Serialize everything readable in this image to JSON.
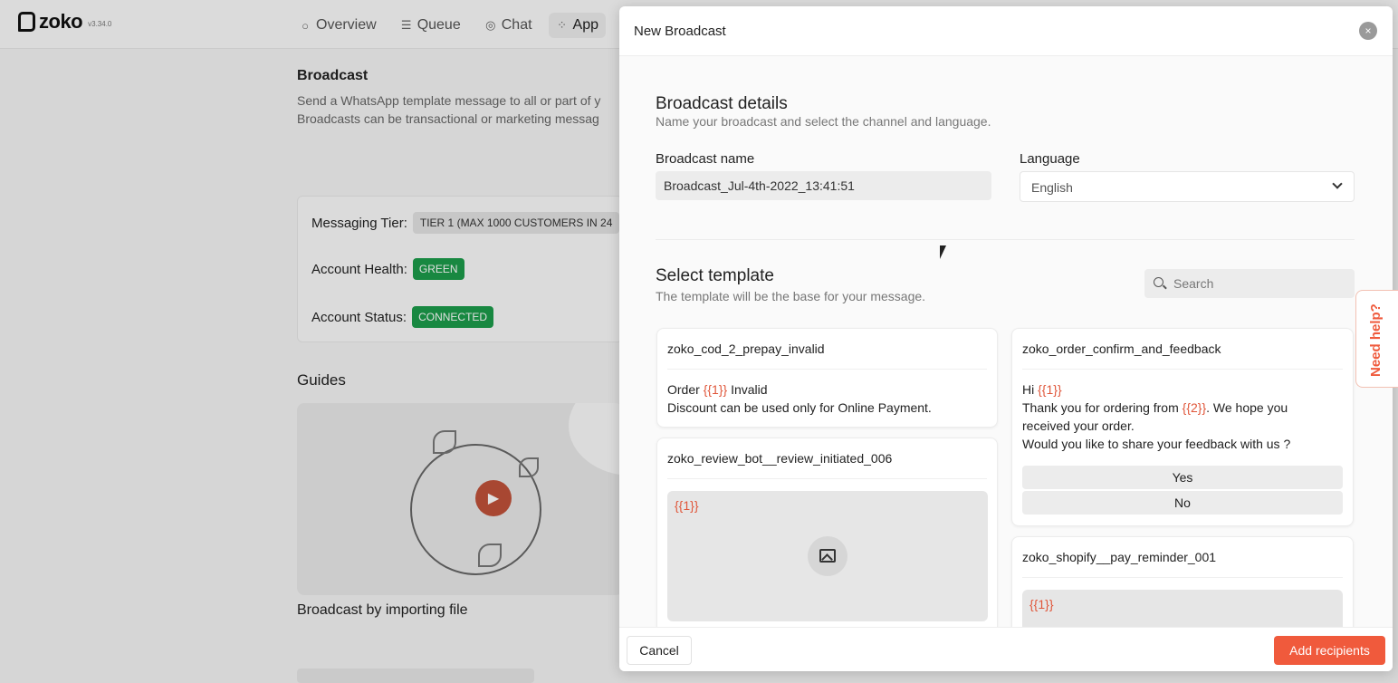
{
  "app": {
    "logo_text": "zoko",
    "version": "v3.34.0"
  },
  "nav": [
    {
      "label": "Overview",
      "icon": "circle-icon"
    },
    {
      "label": "Queue",
      "icon": "list-icon"
    },
    {
      "label": "Chat",
      "icon": "chat-icon"
    },
    {
      "label": "App",
      "icon": "apps-icon"
    }
  ],
  "broadcast_page": {
    "title": "Broadcast",
    "desc_line1": "Send a WhatsApp template message to all or part of y",
    "desc_line2": "Broadcasts can be transactional or marketing messag",
    "messaging_tier_label": "Messaging Tier:",
    "messaging_tier_value": "TIER 1 (MAX 1000 CUSTOMERS IN 24",
    "account_health_label": "Account Health:",
    "account_health_value": "GREEN",
    "account_status_label": "Account Status:",
    "account_status_value": "CONNECTED",
    "status_color": "#1c9b4a",
    "guides_title": "Guides",
    "guide_caption": "Broadcast by importing file"
  },
  "modal": {
    "title": "New Broadcast",
    "details_title": "Broadcast details",
    "details_sub": "Name your broadcast and select the channel and language.",
    "name_label": "Broadcast name",
    "name_value": "Broadcast_Jul-4th-2022_13:41:51",
    "language_label": "Language",
    "language_value": "English",
    "template_title": "Select template",
    "template_sub": "The template will be the base for your message.",
    "search_placeholder": "Search",
    "cancel_label": "Cancel",
    "add_label": "Add recipients",
    "accent_color": "#f05a3c",
    "templates": {
      "t1": {
        "name": "zoko_cod_2_prepay_invalid",
        "line1_pre": "Order ",
        "line1_var": "{{1}}",
        "line1_post": " Invalid",
        "line2": "Discount can be used only for Online Payment."
      },
      "t2": {
        "name": "zoko_review_bot__review_initiated_006",
        "media_var": "{{1}}"
      },
      "t3": {
        "name": "zoko_order_confirm_and_feedback",
        "line1_pre": "Hi ",
        "line1_var": "{{1}}",
        "line2_pre": "Thank you for ordering from ",
        "line2_var": "{{2}}",
        "line2_post": ". We hope you",
        "line3": "received your order.",
        "line4": "Would you like to share your feedback with us ?",
        "button1": "Yes",
        "button2": "No"
      },
      "t4": {
        "name": "zoko_shopify__pay_reminder_001",
        "media_var": "{{1}}"
      }
    }
  },
  "help": {
    "label": "Need help?"
  }
}
